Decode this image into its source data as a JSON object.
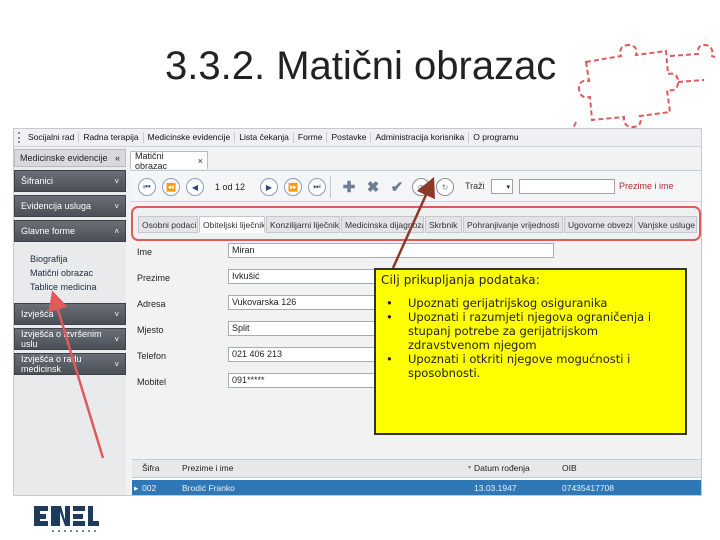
{
  "slide": {
    "title": "3.3.2. Matični obrazac"
  },
  "menu": [
    "Socijalni rad",
    "Radna terapija",
    "Medicinske evidencije",
    "Lista čekanja",
    "Forme",
    "Postavke",
    "Administracija korisnika",
    "O programu"
  ],
  "sidebar": {
    "header": "Medicinske evidencije",
    "header_chevron": "«",
    "top_sections": [
      {
        "label": "Šifranici",
        "arrow": "˅"
      },
      {
        "label": "Evidencija usluga",
        "arrow": "˅"
      },
      {
        "label": "Glavne forme",
        "arrow": "˄"
      }
    ],
    "sub_items": [
      "Biografija",
      "Matični obrazac",
      "Tablice medicina"
    ],
    "bottom_sections": [
      {
        "label": "Izvješća",
        "arrow": "˅"
      },
      {
        "label": "Izvješća o izvršenim uslu",
        "arrow": "˅"
      },
      {
        "label": "Izvješća o radu medicinsk",
        "arrow": "˅"
      }
    ]
  },
  "document_tab": {
    "label": "Matični obrazac",
    "close": "×"
  },
  "toolbar": {
    "pager": "1 od 12",
    "search_label": "Traži",
    "search_dropdown": "▾",
    "search_by": "Prezime i ime",
    "icons": [
      "first-record-icon",
      "prev-page-icon",
      "prev-record-icon",
      "next-record-icon",
      "next-page-icon",
      "last-record-icon",
      "add-icon",
      "delete-icon",
      "confirm-icon",
      "cancel-icon",
      "refresh-icon"
    ]
  },
  "tabs": [
    "Osobni podaci",
    "Obiteljski liječnik",
    "Konzilijarni liječnik",
    "Medicinska dijagnoza",
    "Skrbnik",
    "Pohranjivanje vrijednosti",
    "Ugovorne obveze",
    "Vanjske usluge"
  ],
  "active_tab": "Obiteljski liječnik",
  "form": [
    {
      "label": "Ime",
      "value": "Miran"
    },
    {
      "label": "Prezime",
      "value": "Ivkušić"
    },
    {
      "label": "Adresa",
      "value": "Vukovarska 126"
    },
    {
      "label": "Mjesto",
      "value": "Split"
    },
    {
      "label": "Telefon",
      "value": "021 406 213"
    },
    {
      "label": "Mobitel",
      "value": "091*****"
    }
  ],
  "grid": {
    "columns": [
      "Šifra",
      "Prezime i ime",
      "Datum rođenja",
      "OIB"
    ],
    "rows": [
      {
        "marker": "▸",
        "cells": [
          "002",
          "Brodić Franko",
          "13.03.1947",
          "07435417708"
        ]
      }
    ]
  },
  "callout": {
    "title": "Cilj prikupljanja podataka:",
    "items": [
      "Upoznati gerijatrijskog osiguranika",
      "Upoznati i razumjeti njegova ograničenja i stupanj potrebe za gerijatrijskom zdravstvenom njegom",
      "Upoznati i otkriti njegove mogućnosti i sposobnosti."
    ]
  },
  "colors": {
    "highlight": "#ffff00",
    "annotation_red": "#e05a5a",
    "selection_blue": "#2f78b8",
    "arrow_brown": "#8b3a2a"
  }
}
